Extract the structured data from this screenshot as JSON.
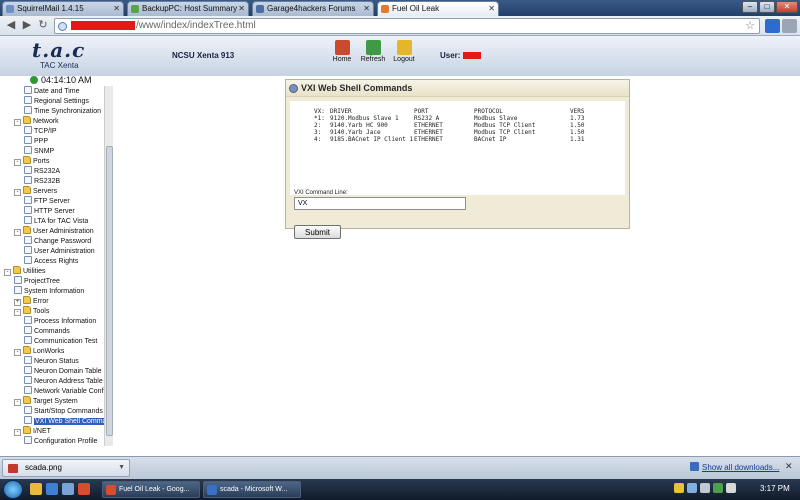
{
  "browser": {
    "tabs": [
      {
        "label": "SquirrelMail 1.4.15",
        "active": false
      },
      {
        "label": "BackupPC: Host Summary",
        "active": false
      },
      {
        "label": "Garage4hackers Forums",
        "active": false
      },
      {
        "label": "Fuel Oil Leak",
        "active": true
      }
    ],
    "url_path": "/www/index/indexTree.html"
  },
  "header": {
    "logo": "t.a.c",
    "logo_sub": "TAC Xenta",
    "device": "NCSU Xenta 913",
    "home_label": "Home",
    "refresh_label": "Refresh",
    "logout_label": "Logout",
    "user_label": "User:",
    "clock": "04:14:10 AM"
  },
  "tree": [
    {
      "label": "Date and Time",
      "level": 2,
      "type": "doc",
      "exp": ""
    },
    {
      "label": "Regional Settings",
      "level": 2,
      "type": "doc",
      "exp": ""
    },
    {
      "label": "Time Synchronization",
      "level": 2,
      "type": "doc",
      "exp": ""
    },
    {
      "label": "Network",
      "level": 1,
      "type": "folder",
      "exp": "-"
    },
    {
      "label": "TCP/IP",
      "level": 2,
      "type": "doc",
      "exp": ""
    },
    {
      "label": "PPP",
      "level": 2,
      "type": "doc",
      "exp": ""
    },
    {
      "label": "SNMP",
      "level": 2,
      "type": "doc",
      "exp": ""
    },
    {
      "label": "Ports",
      "level": 1,
      "type": "folder",
      "exp": "-"
    },
    {
      "label": "RS232A",
      "level": 2,
      "type": "doc",
      "exp": ""
    },
    {
      "label": "RS232B",
      "level": 2,
      "type": "doc",
      "exp": ""
    },
    {
      "label": "Servers",
      "level": 1,
      "type": "folder",
      "exp": "-"
    },
    {
      "label": "FTP Server",
      "level": 2,
      "type": "doc",
      "exp": ""
    },
    {
      "label": "HTTP Server",
      "level": 2,
      "type": "doc",
      "exp": ""
    },
    {
      "label": "LTA for TAC Vista",
      "level": 2,
      "type": "doc",
      "exp": ""
    },
    {
      "label": "User Administration",
      "level": 1,
      "type": "folder",
      "exp": "-"
    },
    {
      "label": "Change Password",
      "level": 2,
      "type": "doc",
      "exp": ""
    },
    {
      "label": "User Administration",
      "level": 2,
      "type": "doc",
      "exp": ""
    },
    {
      "label": "Access Rights",
      "level": 2,
      "type": "doc",
      "exp": ""
    },
    {
      "label": "Utilities",
      "level": 0,
      "type": "folder",
      "exp": "-"
    },
    {
      "label": "ProjectTree",
      "level": 1,
      "type": "doc",
      "exp": ""
    },
    {
      "label": "System Information",
      "level": 1,
      "type": "doc",
      "exp": ""
    },
    {
      "label": "Error",
      "level": 1,
      "type": "folder",
      "exp": "+"
    },
    {
      "label": "Tools",
      "level": 1,
      "type": "folder",
      "exp": "-"
    },
    {
      "label": "Process Information",
      "level": 2,
      "type": "doc",
      "exp": ""
    },
    {
      "label": "Commands",
      "level": 2,
      "type": "doc",
      "exp": ""
    },
    {
      "label": "Communication Test",
      "level": 2,
      "type": "doc",
      "exp": ""
    },
    {
      "label": "LonWorks",
      "level": 1,
      "type": "folder",
      "exp": "-"
    },
    {
      "label": "Neuron Status",
      "level": 2,
      "type": "doc",
      "exp": ""
    },
    {
      "label": "Neuron Domain Table",
      "level": 2,
      "type": "doc",
      "exp": ""
    },
    {
      "label": "Neuron Address Table",
      "level": 2,
      "type": "doc",
      "exp": ""
    },
    {
      "label": "Network Variable Config",
      "level": 2,
      "type": "doc",
      "exp": ""
    },
    {
      "label": "Target System",
      "level": 1,
      "type": "folder",
      "exp": "-"
    },
    {
      "label": "Start/Stop Commands",
      "level": 2,
      "type": "doc",
      "exp": ""
    },
    {
      "label": "VXI Web Shell Commands",
      "level": 2,
      "type": "doc",
      "exp": "",
      "selected": true
    },
    {
      "label": "I/NET",
      "level": 1,
      "type": "folder",
      "exp": "-"
    },
    {
      "label": "Configuration Profile",
      "level": 2,
      "type": "doc",
      "exp": ""
    }
  ],
  "panel": {
    "title": "VXI Web Shell Commands",
    "headers": [
      "VX:",
      "DRIVER",
      "PORT",
      "PROTOCOL",
      "VERS"
    ],
    "rows": [
      [
        "*1:",
        "9120.Modbus Slave 1",
        "RS232 A",
        "Modbus Slave",
        "1.73"
      ],
      [
        "2:",
        "9140.Yarb HC 900",
        "ETHERNET",
        "Modbus TCP Client",
        "1.50"
      ],
      [
        "3:",
        "9140.Yarb Jace",
        "ETHERNET",
        "Modbus TCP Client",
        "1.50"
      ],
      [
        "4:",
        "9185.BACnet IP Client 1",
        "ETHERNET",
        "BACnet IP",
        "1.31"
      ]
    ],
    "cmd_label": "VXI Command Line:",
    "cmd_value": "VX",
    "submit_label": "Submit"
  },
  "downloads": {
    "file": "scada.png",
    "show_all": "Show all downloads..."
  },
  "taskbar": {
    "tasks": [
      "Fuel Oil Leak - Goog...",
      "scada - Microsoft W..."
    ],
    "time": "3:17 PM"
  },
  "colors": {
    "panel_bg": "#efebd7",
    "selected": "#2f5fbf",
    "redaction": "#e21a1a"
  }
}
